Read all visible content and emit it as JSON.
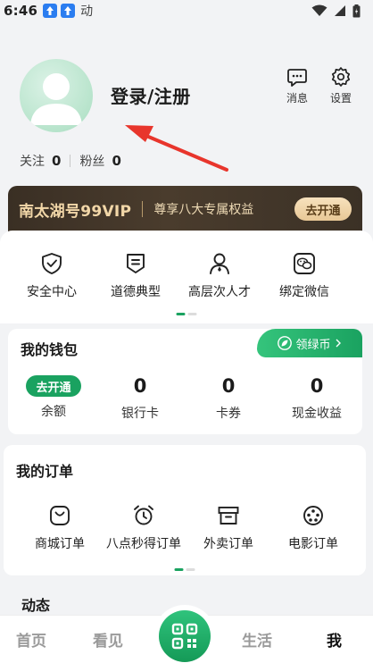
{
  "status_bar": {
    "time": "6:46",
    "notification_text": "动"
  },
  "profile": {
    "login_label": "登录/注册",
    "messages_label": "消息",
    "settings_label": "设置",
    "follow_label": "关注",
    "follow_count": "0",
    "fans_label": "粉丝",
    "fans_count": "0"
  },
  "vip": {
    "name": "南太湖号99VIP",
    "benefit": "尊享八大专属权益",
    "open_label": "去开通"
  },
  "services": [
    {
      "label": "安全中心",
      "icon": "shield-check-icon"
    },
    {
      "label": "道德典型",
      "icon": "badge-icon"
    },
    {
      "label": "高层次人才",
      "icon": "person-icon"
    },
    {
      "label": "绑定微信",
      "icon": "wechat-icon"
    }
  ],
  "wallet": {
    "title": "我的钱包",
    "green_coin_label": "领绿币",
    "balance_action": "去开通",
    "balance_label": "余额",
    "bank_card_value": "0",
    "bank_card_label": "银行卡",
    "coupon_value": "0",
    "coupon_label": "卡券",
    "cash_income_value": "0",
    "cash_income_label": "现金收益"
  },
  "orders": {
    "title": "我的订单",
    "items": [
      {
        "label": "商城订单",
        "icon": "shopping-bag-icon"
      },
      {
        "label": "八点秒得订单",
        "icon": "alarm-clock-icon"
      },
      {
        "label": "外卖订单",
        "icon": "box-icon"
      },
      {
        "label": "电影订单",
        "icon": "film-reel-icon"
      }
    ]
  },
  "feed": {
    "title": "动态"
  },
  "nav": {
    "home": "首页",
    "watch": "看见",
    "scan_icon": "qr-scan-icon",
    "life": "生活",
    "me": "我"
  },
  "colors": {
    "brand_green": "#1aa260",
    "vip_dark": "#3a2f24",
    "vip_gold": "#f2d7a8",
    "arrow_red": "#e8352c"
  }
}
